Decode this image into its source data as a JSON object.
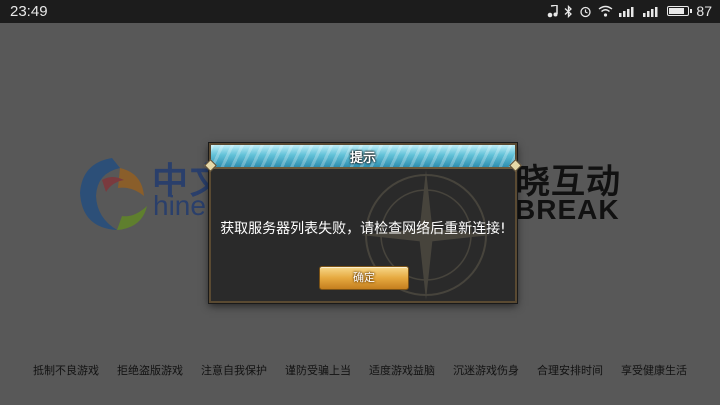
{
  "status_bar": {
    "time": "23:49",
    "battery_level": "87",
    "battery_fraction": 0.87,
    "icons": [
      "music-note-icon",
      "bluetooth-icon",
      "alarm-icon",
      "wifi-icon",
      "signal-icon",
      "signal-icon",
      "battery-icon"
    ]
  },
  "splash": {
    "left_logo_cn": "中文",
    "left_logo_en": "hine",
    "right_logo_cn": "晓互动",
    "right_logo_en": "BREAK",
    "health_tips": [
      "抵制不良游戏",
      "拒绝盗版游戏",
      "注意自我保护",
      "谨防受骗上当",
      "适度游戏益脑",
      "沉迷游戏伤身",
      "合理安排时间",
      "享受健康生活"
    ]
  },
  "dialog": {
    "title": "提示",
    "message": "获取服务器列表失败，请检查网络后重新连接!",
    "ok_label": "确定"
  },
  "colors": {
    "header_cyan": "#63c2d8",
    "button_gold": "#e6a93f",
    "dialog_bg": "#2a2a2a",
    "overlay_bg": "#585858"
  }
}
